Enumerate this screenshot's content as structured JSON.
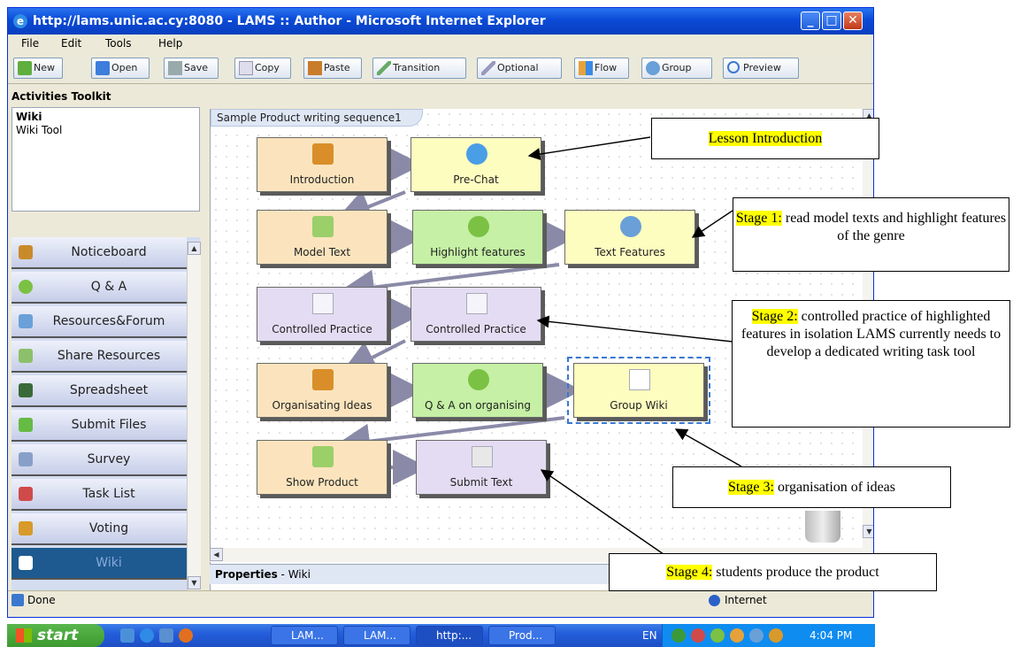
{
  "window": {
    "title": "http://lams.unic.ac.cy:8080 - LAMS :: Author - Microsoft Internet Explorer",
    "buttons": {
      "minimize": "_",
      "maximize": "□",
      "close": "✕"
    }
  },
  "menu": [
    "File",
    "Edit",
    "Tools",
    "Help"
  ],
  "toolbar": [
    {
      "label": "New",
      "icon": "new-icon"
    },
    {
      "label": "Open",
      "icon": "open-folder-icon"
    },
    {
      "label": "Save",
      "icon": "save-icon"
    },
    {
      "label": "Copy",
      "icon": "copy-icon"
    },
    {
      "label": "Paste",
      "icon": "paste-icon"
    },
    {
      "label": "Transition",
      "icon": "transition-pen-icon"
    },
    {
      "label": "Optional",
      "icon": "optional-pen-icon"
    },
    {
      "label": "Flow",
      "icon": "flow-icon"
    },
    {
      "label": "Group",
      "icon": "group-icon"
    },
    {
      "label": "Preview",
      "icon": "preview-magnifier-icon"
    }
  ],
  "toolkit": {
    "header": "Activities Toolkit",
    "selected_title": "Wiki",
    "selected_desc": "Wiki Tool",
    "tools": [
      {
        "label": "Noticeboard",
        "icon": "noticeboard-icon",
        "color": "#c98a2a"
      },
      {
        "label": "Q & A",
        "icon": "question-icon",
        "color": "#7bc143"
      },
      {
        "label": "Resources&Forum",
        "icon": "resources-forum-icon",
        "color": "#6aa0d8"
      },
      {
        "label": "Share Resources",
        "icon": "share-resources-icon",
        "color": "#8cc06a"
      },
      {
        "label": "Spreadsheet",
        "icon": "spreadsheet-icon",
        "color": "#3a6a3a"
      },
      {
        "label": "Submit Files",
        "icon": "submit-files-icon",
        "color": "#66bb44"
      },
      {
        "label": "Survey",
        "icon": "survey-icon",
        "color": "#88a0c8"
      },
      {
        "label": "Task List",
        "icon": "task-list-icon",
        "color": "#d04a4a"
      },
      {
        "label": "Voting",
        "icon": "voting-icon",
        "color": "#d89a2a"
      },
      {
        "label": "Wiki",
        "icon": "wiki-icon",
        "color": "#ffffff"
      }
    ],
    "selected_tool": "Wiki"
  },
  "canvas": {
    "sequence_title": "Sample Product writing sequence1",
    "activities": [
      {
        "id": "introduction",
        "label": "Introduction",
        "color": "orange",
        "icon": "noticeboard-icon"
      },
      {
        "id": "pre-chat",
        "label": "Pre-Chat",
        "color": "yellow",
        "icon": "chat-bubble-icon"
      },
      {
        "id": "model-text",
        "label": "Model Text",
        "color": "orange",
        "icon": "share-resources-icon"
      },
      {
        "id": "highlight-features",
        "label": "Highlight features",
        "color": "green",
        "icon": "question-icon"
      },
      {
        "id": "text-features",
        "label": "Text Features",
        "color": "yellow",
        "icon": "forum-people-icon"
      },
      {
        "id": "controlled-practice-1",
        "label": "Controlled Practice",
        "color": "purple",
        "icon": "survey-list-icon"
      },
      {
        "id": "controlled-practice-2",
        "label": "Controlled Practice",
        "color": "purple",
        "icon": "survey-list-icon"
      },
      {
        "id": "organisating-ideas",
        "label": "Organisating Ideas",
        "color": "orange",
        "icon": "noticeboard-icon"
      },
      {
        "id": "qa-organising",
        "label": "Q & A on organising",
        "color": "green",
        "icon": "question-icon"
      },
      {
        "id": "group-wiki",
        "label": "Group Wiki",
        "color": "yellow",
        "icon": "wiki-icon"
      },
      {
        "id": "show-product",
        "label": "Show Product",
        "color": "orange",
        "icon": "share-resources-icon"
      },
      {
        "id": "submit-text",
        "label": "Submit Text",
        "color": "purple",
        "icon": "submit-arrow-icon"
      }
    ]
  },
  "properties": {
    "label": "Properties",
    "value": "Wiki"
  },
  "status": {
    "left": "Done",
    "zone": "Internet"
  },
  "taskbar": {
    "start": "start",
    "tasks": [
      "LAM...",
      "LAM...",
      "http:...",
      "Prod..."
    ],
    "lang": "EN",
    "clock": "4:04 PM"
  },
  "annotations": {
    "lesson_intro": "Lesson Introduction",
    "stage1_tag": "Stage 1:",
    "stage1_text": "read model texts and highlight features of the genre",
    "stage2_tag": "Stage 2:",
    "stage2_text": "controlled practice of highlighted features in isolation LAMS currently needs to develop a dedicated writing task tool",
    "stage3_tag": "Stage 3:",
    "stage3_text": "organisation of ideas",
    "stage4_tag": "Stage 4:",
    "stage4_text": "students produce the product"
  }
}
